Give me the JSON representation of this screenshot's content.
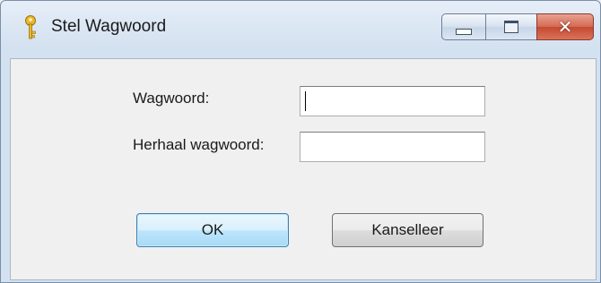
{
  "window": {
    "title": "Stel Wagwoord",
    "icon": "key-icon",
    "controls": [
      "minimize-icon",
      "maximize-icon",
      "close-icon"
    ],
    "close_glyph": "✕"
  },
  "form": {
    "password_label": "Wagwoord:",
    "password_value": "",
    "repeat_label": "Herhaal wagwoord:",
    "repeat_value": ""
  },
  "buttons": {
    "ok_label": "OK",
    "cancel_label": "Kanselleer"
  },
  "colors": {
    "close_button": "#c44a30",
    "default_button_border": "#3c7fb1",
    "key_icon": "#e9b82a"
  }
}
